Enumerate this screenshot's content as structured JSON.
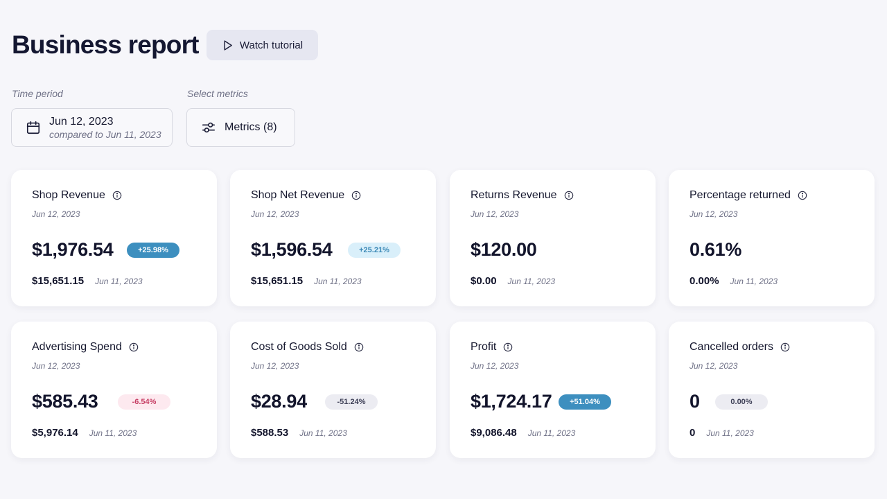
{
  "header": {
    "title": "Business report",
    "tutorial_label": "Watch tutorial"
  },
  "filters": {
    "time_period_label": "Time period",
    "date_main": "Jun 12, 2023",
    "date_compare": "compared to Jun 11, 2023",
    "metrics_label": "Select metrics",
    "metrics_button": "Metrics (8)"
  },
  "colors": {
    "badge_up_strong": "#3d8fbf",
    "badge_up_light": "#d9effa",
    "badge_down": "#fde9ef",
    "badge_neutral": "#ececf2"
  },
  "cards": [
    {
      "title": "Shop Revenue",
      "date": "Jun 12, 2023",
      "value": "$1,976.54",
      "change": "+25.98%",
      "prev_value": "$15,651.15",
      "prev_date": "Jun 11, 2023"
    },
    {
      "title": "Shop Net Revenue",
      "date": "Jun 12, 2023",
      "value": "$1,596.54",
      "change": "+25.21%",
      "prev_value": "$15,651.15",
      "prev_date": "Jun 11, 2023"
    },
    {
      "title": "Returns Revenue",
      "date": "Jun 12, 2023",
      "value": "$120.00",
      "prev_value": "$0.00",
      "prev_date": "Jun 11, 2023"
    },
    {
      "title": "Percentage returned",
      "date": "Jun 12, 2023",
      "value": "0.61%",
      "prev_value": "0.00%",
      "prev_date": "Jun 11, 2023"
    },
    {
      "title": "Advertising Spend",
      "date": "Jun 12, 2023",
      "value": "$585.43",
      "change": "-6.54%",
      "prev_value": "$5,976.14",
      "prev_date": "Jun 11, 2023"
    },
    {
      "title": "Cost of Goods Sold",
      "date": "Jun 12, 2023",
      "value": "$28.94",
      "change": "-51.24%",
      "prev_value": "$588.53",
      "prev_date": "Jun 11, 2023"
    },
    {
      "title": "Profit",
      "date": "Jun 12, 2023",
      "value": "$1,724.17",
      "change": "+51.04%",
      "prev_value": "$9,086.48",
      "prev_date": "Jun 11, 2023"
    },
    {
      "title": "Cancelled orders",
      "date": "Jun 12, 2023",
      "value": "0",
      "change": "0.00%",
      "prev_value": "0",
      "prev_date": "Jun 11, 2023"
    }
  ]
}
